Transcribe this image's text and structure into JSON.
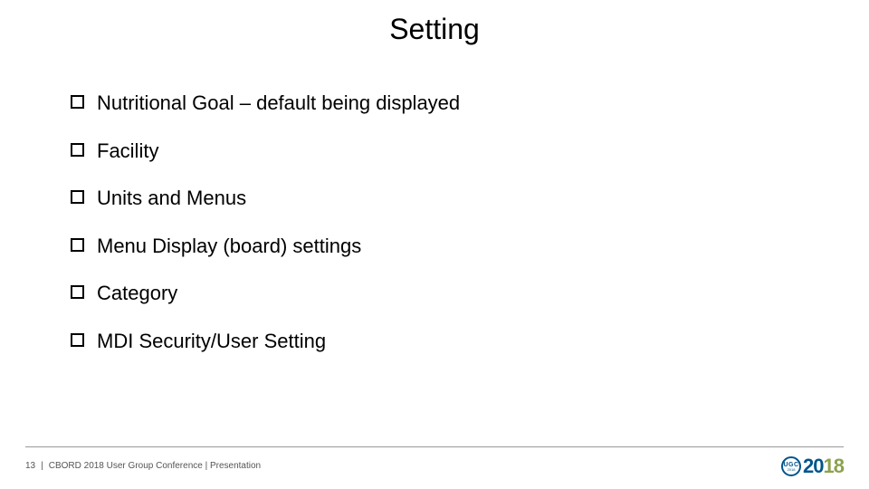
{
  "title": "Setting",
  "bullets": [
    "Nutritional Goal – default being displayed",
    "Facility",
    "Units and Menus",
    "Menu Display (board) settings",
    "Category",
    "MDI Security/User Setting"
  ],
  "footer": {
    "page": "13",
    "sep": "|",
    "text": "CBORD 2018 User Group Conference | Presentation"
  },
  "logo": {
    "badge_top": "UGC",
    "badge_bottom": "2018",
    "year_a": "20",
    "year_b": "18"
  }
}
